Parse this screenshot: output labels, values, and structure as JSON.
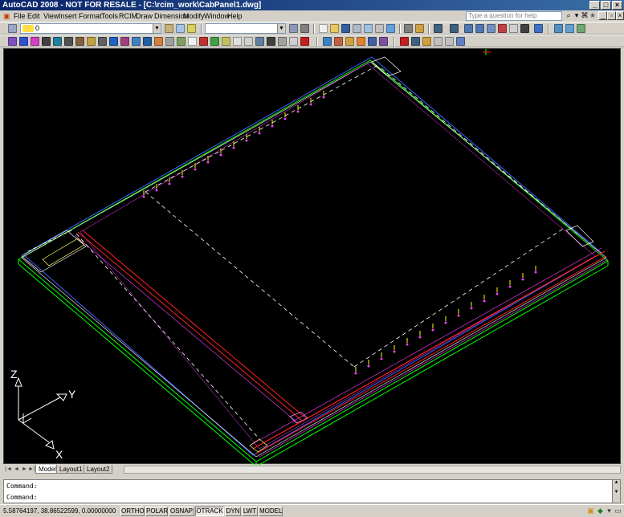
{
  "window": {
    "title": "AutoCAD 2008 - NOT FOR RESALE - [C:\\rcim_work\\CabPanel1.dwg]",
    "minimize": "_",
    "maximize": "□",
    "close": "×"
  },
  "menu": {
    "items": [
      "File",
      "Edit",
      "View",
      "Insert",
      "Format",
      "Tools",
      "RCIM",
      "Draw",
      "Dimension",
      "Modify",
      "Window",
      "Help"
    ],
    "help_placeholder": "Type a question for help"
  },
  "toolbar": {
    "layer_value": "0",
    "style_value": ""
  },
  "canvas": {
    "background": "#000000",
    "ucs": {
      "z": "Z",
      "y": "Y",
      "x": "X"
    }
  },
  "layout_tabs": {
    "nav": [
      "|◄",
      "◄",
      "►",
      "►|"
    ],
    "tabs": [
      "Model",
      "Layout1",
      "Layout2"
    ],
    "active": "Model"
  },
  "command": {
    "history": "Command:",
    "prompt": "Command:"
  },
  "status": {
    "coords": "5.58764197,  38.86522599, 0.00000000",
    "buttons": [
      "ORTHO",
      "POLAR",
      "OSNAP",
      "OTRACK",
      "DYN",
      "LWT",
      "MODEL"
    ],
    "on": [
      "OTRACK"
    ]
  },
  "colors": {
    "titlebar": "#0a246a",
    "green": "#00ff00",
    "red": "#ff0000",
    "magenta": "#ff40ff",
    "blue": "#4040ff",
    "white": "#ffffff",
    "yellow": "#ffff00"
  }
}
